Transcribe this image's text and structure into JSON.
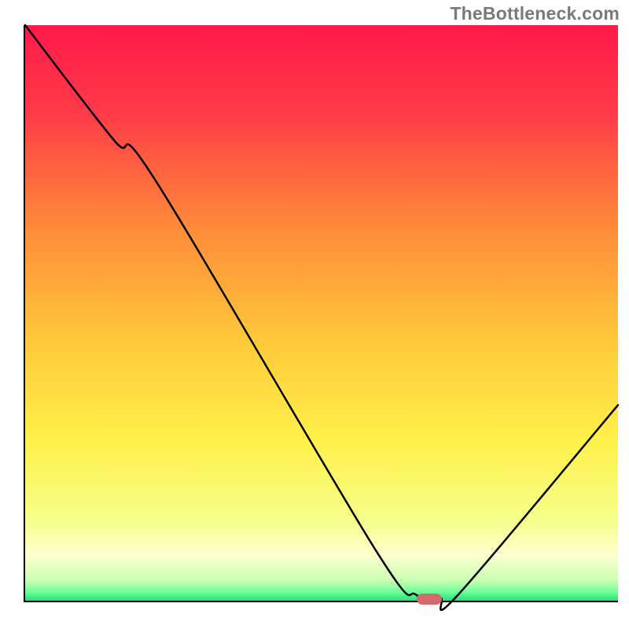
{
  "watermark": "TheBottleneck.com",
  "chart_data": {
    "type": "line",
    "title": "",
    "xlabel": "",
    "ylabel": "",
    "xlim": [
      0,
      100
    ],
    "ylim": [
      0,
      100
    ],
    "x": [
      0,
      15,
      22,
      59,
      66,
      70,
      73,
      100
    ],
    "y": [
      100,
      80,
      73,
      9,
      1,
      0.5,
      1,
      34
    ],
    "marker": {
      "x": 68,
      "y": 0.5,
      "color": "#d46a6a"
    },
    "gradient_stops": [
      {
        "pos": 0.0,
        "color": "#ff1a4b"
      },
      {
        "pos": 0.15,
        "color": "#ff3a48"
      },
      {
        "pos": 0.35,
        "color": "#ff8a3a"
      },
      {
        "pos": 0.55,
        "color": "#ffc93a"
      },
      {
        "pos": 0.72,
        "color": "#fff04a"
      },
      {
        "pos": 0.86,
        "color": "#f6ff8a"
      },
      {
        "pos": 0.92,
        "color": "#ffffd0"
      },
      {
        "pos": 0.965,
        "color": "#c8ffb0"
      },
      {
        "pos": 0.985,
        "color": "#6cff9a"
      },
      {
        "pos": 1.0,
        "color": "#25e07a"
      }
    ]
  }
}
